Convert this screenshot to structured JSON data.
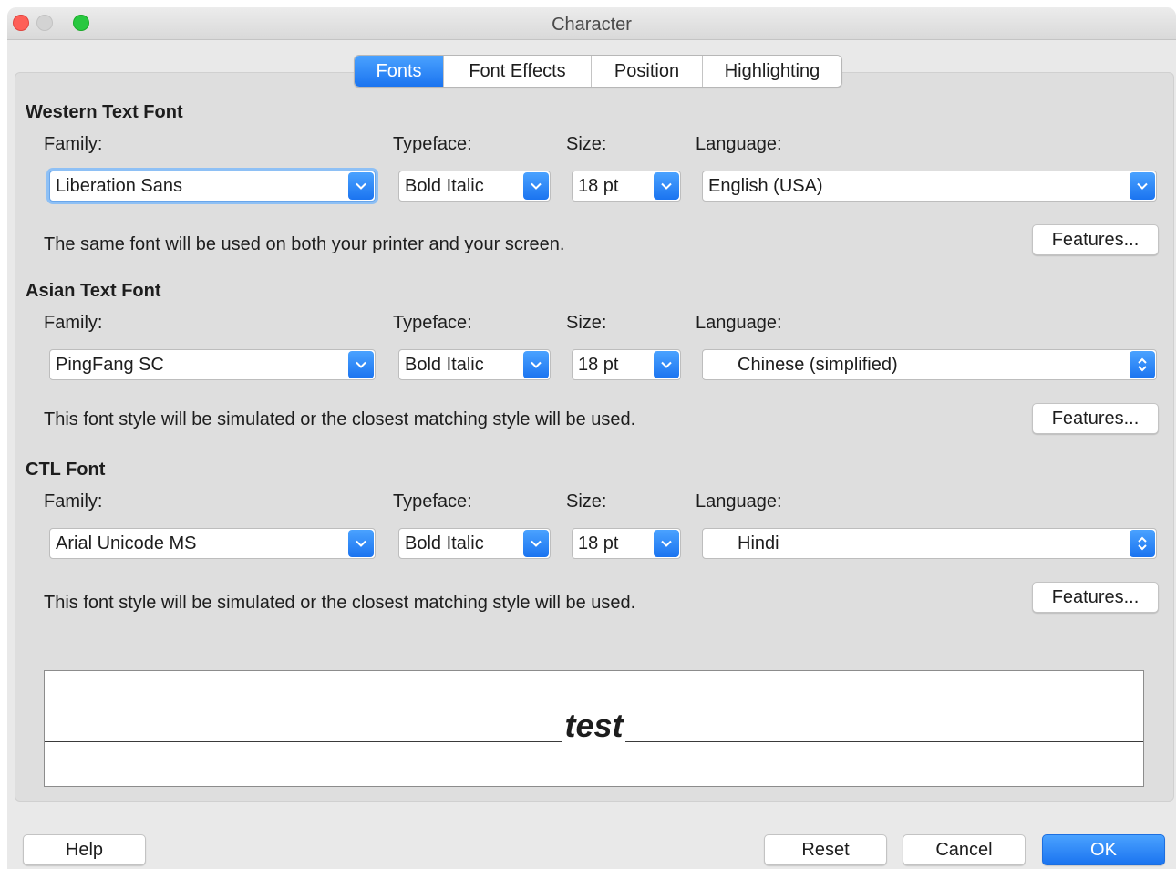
{
  "window": {
    "title": "Character"
  },
  "tabs": [
    {
      "label": "Fonts",
      "active": true
    },
    {
      "label": "Font Effects",
      "active": false
    },
    {
      "label": "Position",
      "active": false
    },
    {
      "label": "Highlighting",
      "active": false
    }
  ],
  "labels": {
    "family": "Family:",
    "typeface": "Typeface:",
    "size": "Size:",
    "language": "Language:"
  },
  "sections": [
    {
      "title": "Western Text Font",
      "family": "Liberation Sans",
      "typeface": "Bold Italic",
      "size": "18 pt",
      "language": "English (USA)",
      "info": "The same font will be used on both your printer and your screen.",
      "features": "Features..."
    },
    {
      "title": "Asian Text Font",
      "family": "PingFang SC",
      "typeface": "Bold Italic",
      "size": "18 pt",
      "language": "Chinese (simplified)",
      "info": "This font style will be simulated or the closest matching style will be used.",
      "features": "Features..."
    },
    {
      "title": "CTL Font",
      "family": "Arial Unicode MS",
      "typeface": "Bold Italic",
      "size": "18 pt",
      "language": "Hindi",
      "info": "This font style will be simulated or the closest matching style will be used.",
      "features": "Features..."
    }
  ],
  "preview": {
    "text": "test"
  },
  "buttons": {
    "help": "Help",
    "reset": "Reset",
    "cancel": "Cancel",
    "ok": "OK"
  },
  "colors": {
    "accent": "#1b74f0",
    "close": "#fe5f57",
    "maximize": "#28c840"
  },
  "icons": {
    "dropdown": "chevron-down-icon",
    "updown": "up-down-arrows-icon"
  }
}
